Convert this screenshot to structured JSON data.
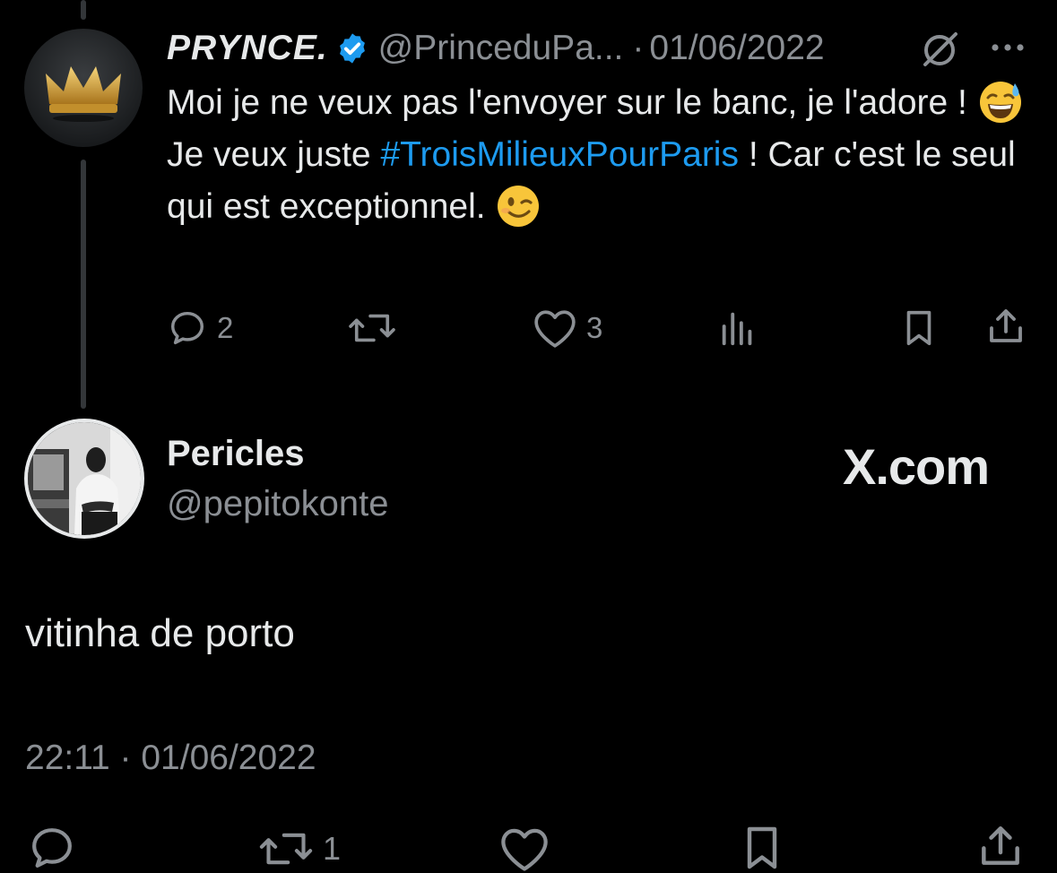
{
  "parent_tweet": {
    "display_name": "PRYNCE.",
    "handle": "@PrinceduPa...",
    "separator": "·",
    "date": "01/06/2022",
    "text_part1": "Moi je ne veux pas l'envoyer sur le banc, je l'adore !",
    "emoji1": "sweat-smile",
    "text_part2": "Je veux juste",
    "hashtag": "#TroisMilieuxPourParis",
    "text_part3": "! Car c'est le seul qui est exceptionnel.",
    "emoji2": "wink",
    "reply_count": "2",
    "retweet_count": "",
    "like_count": "3",
    "colors": {
      "hashtag": "#1d9bf0",
      "verified": "#1d9bf0",
      "muted": "#8b8f94"
    }
  },
  "main_tweet": {
    "display_name": "Pericles",
    "handle": "@pepitokonte",
    "text": "vitinha de porto",
    "timestamp": "22:11 · 01/06/2022",
    "retweet_count": "1"
  },
  "watermark": "X.com"
}
